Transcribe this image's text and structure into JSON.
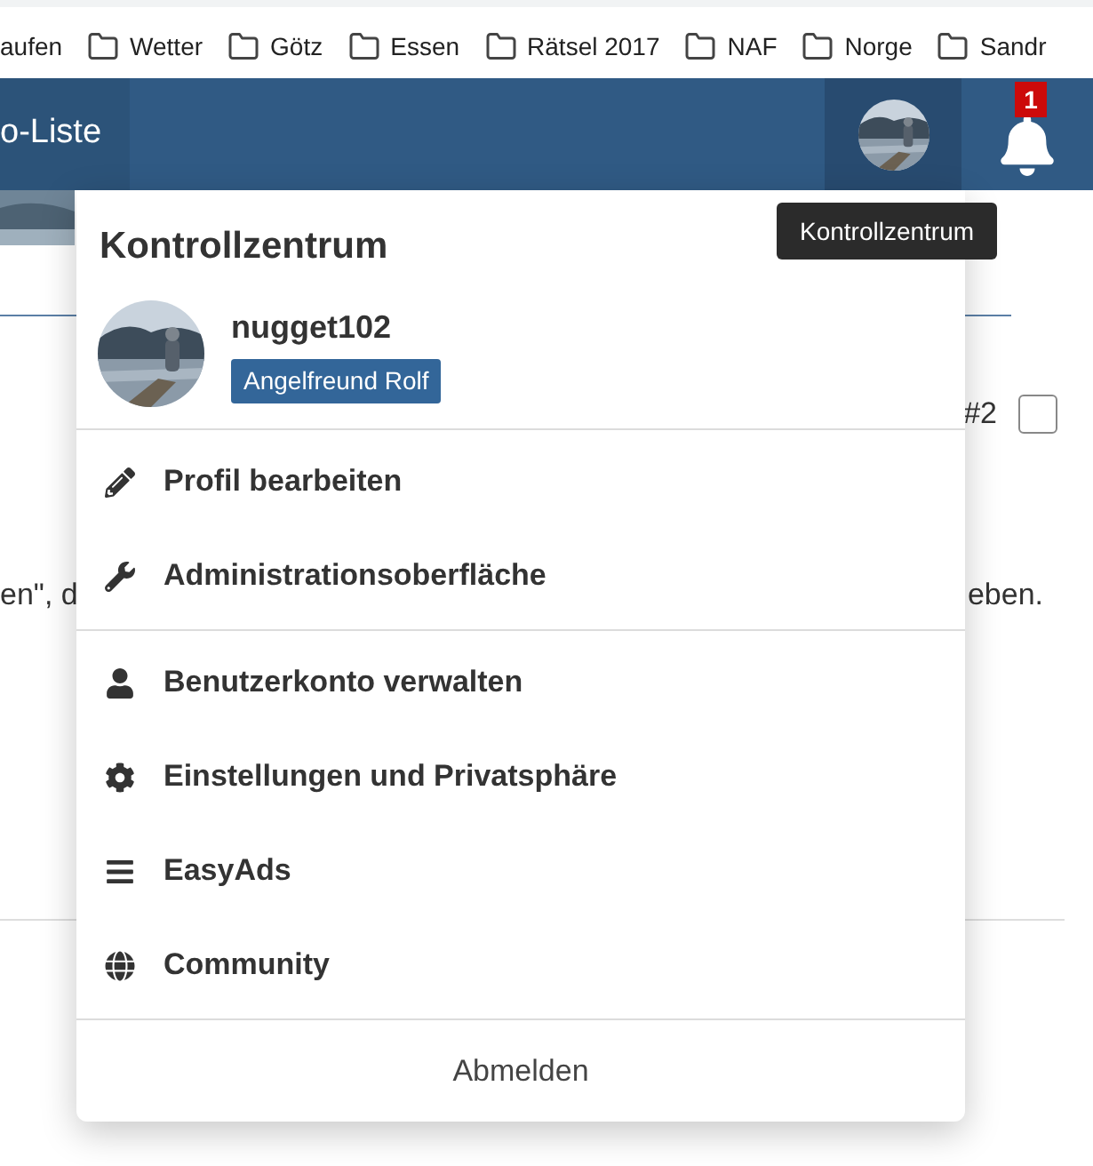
{
  "bookmarks": [
    {
      "label": "aufen"
    },
    {
      "label": "Wetter"
    },
    {
      "label": "Götz"
    },
    {
      "label": "Essen"
    },
    {
      "label": "Rätsel 2017"
    },
    {
      "label": "NAF"
    },
    {
      "label": "Norge"
    },
    {
      "label": "Sandr"
    }
  ],
  "header": {
    "tab": "o-Liste",
    "notifications": {
      "count": "1"
    }
  },
  "tooltip": "Kontrollzentrum",
  "content": {
    "post_number": "#2",
    "checkbox": {
      "checked": false
    },
    "text_left": "en\", d",
    "text_right": "eben."
  },
  "menu": {
    "title": "Kontrollzentrum",
    "user": {
      "name": "nugget102",
      "badge": "Angelfreund Rolf"
    },
    "sections": [
      [
        {
          "label": "Profil bearbeiten"
        },
        {
          "label": "Administrationsoberfläche"
        }
      ],
      [
        {
          "label": "Benutzerkonto verwalten"
        },
        {
          "label": "Einstellungen und Privatsphäre"
        },
        {
          "label": "EasyAds"
        },
        {
          "label": "Community"
        }
      ]
    ],
    "footer": "Abmelden"
  }
}
